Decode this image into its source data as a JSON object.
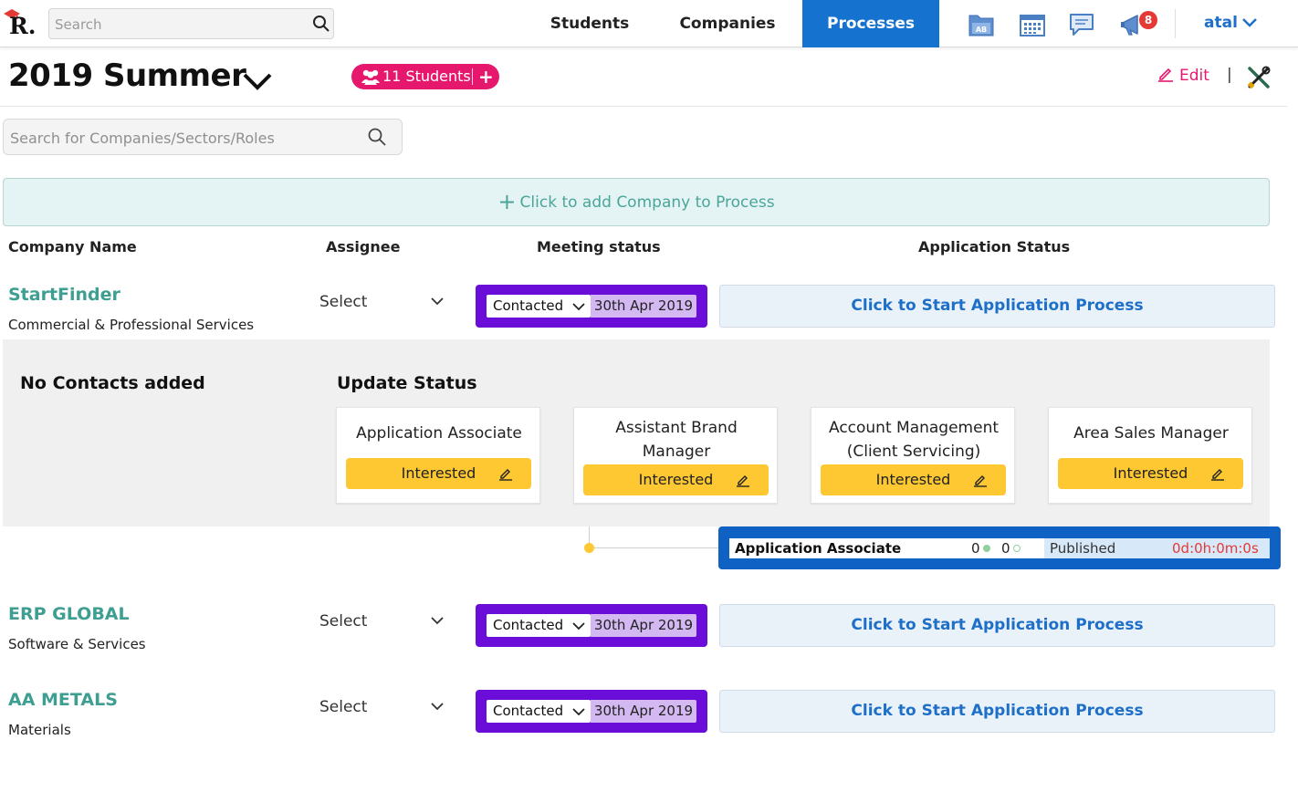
{
  "topbar": {
    "logo_letter": "R.",
    "search_placeholder": "Search",
    "nav": {
      "students": "Students",
      "companies": "Companies",
      "processes": "Processes"
    },
    "notifications_count": "8",
    "user_name": "atal",
    "icons": [
      "folder-ab-icon",
      "calendar-icon",
      "chat-icon",
      "megaphone-icon"
    ]
  },
  "header": {
    "title": "2019 Summer",
    "students_pill": "11 Students",
    "students_add": "+",
    "edit_label": "Edit",
    "separator": "|"
  },
  "search": {
    "placeholder": "Search for Companies/Sectors/Roles"
  },
  "add_company": {
    "label": "Click to add Company to Process"
  },
  "columns": {
    "company_name": "Company Name",
    "assignee": "Assignee",
    "meeting_status": "Meeting status",
    "application_status": "Application Status"
  },
  "companies": [
    {
      "name": "StartFinder",
      "sector": "Commercial & Professional Services",
      "assignee": "Select",
      "meeting_status": "Contacted",
      "meeting_date": "30th Apr 2019",
      "action": "Click to Start Application Process"
    },
    {
      "name": "ERP GLOBAL",
      "sector": "Software & Services",
      "assignee": "Select",
      "meeting_status": "Contacted",
      "meeting_date": "30th Apr 2019",
      "action": "Click to Start Application Process"
    },
    {
      "name": "AA METALS",
      "sector": "Materials",
      "assignee": "Select",
      "meeting_status": "Contacted",
      "meeting_date": "30th Apr 2019",
      "action": "Click to Start Application Process"
    }
  ],
  "expanded": {
    "no_contacts": "No Contacts added",
    "update_status": "Update Status",
    "roles": [
      {
        "title_l1": "Application Associate",
        "title_l2": "",
        "status": "Interested"
      },
      {
        "title_l1": "Assistant Brand",
        "title_l2": "Manager",
        "status": "Interested"
      },
      {
        "title_l1": "Account Management",
        "title_l2": "(Client Servicing)",
        "status": "Interested"
      },
      {
        "title_l1": "Area Sales Manager",
        "title_l2": "",
        "status": "Interested"
      }
    ],
    "application": {
      "role": "Application Associate",
      "count1": "0",
      "count2": "0",
      "status": "Published",
      "timer": "0d:0h:0m:0s"
    }
  },
  "colors": {
    "brand_blue": "#1672cf",
    "accent_pink": "#e5186d",
    "teal": "#3e9e92",
    "meeting_purple": "#6a0dd8",
    "interested_yellow": "#fdc832",
    "app_blue": "#1061c4",
    "timer_red": "#e53935"
  }
}
